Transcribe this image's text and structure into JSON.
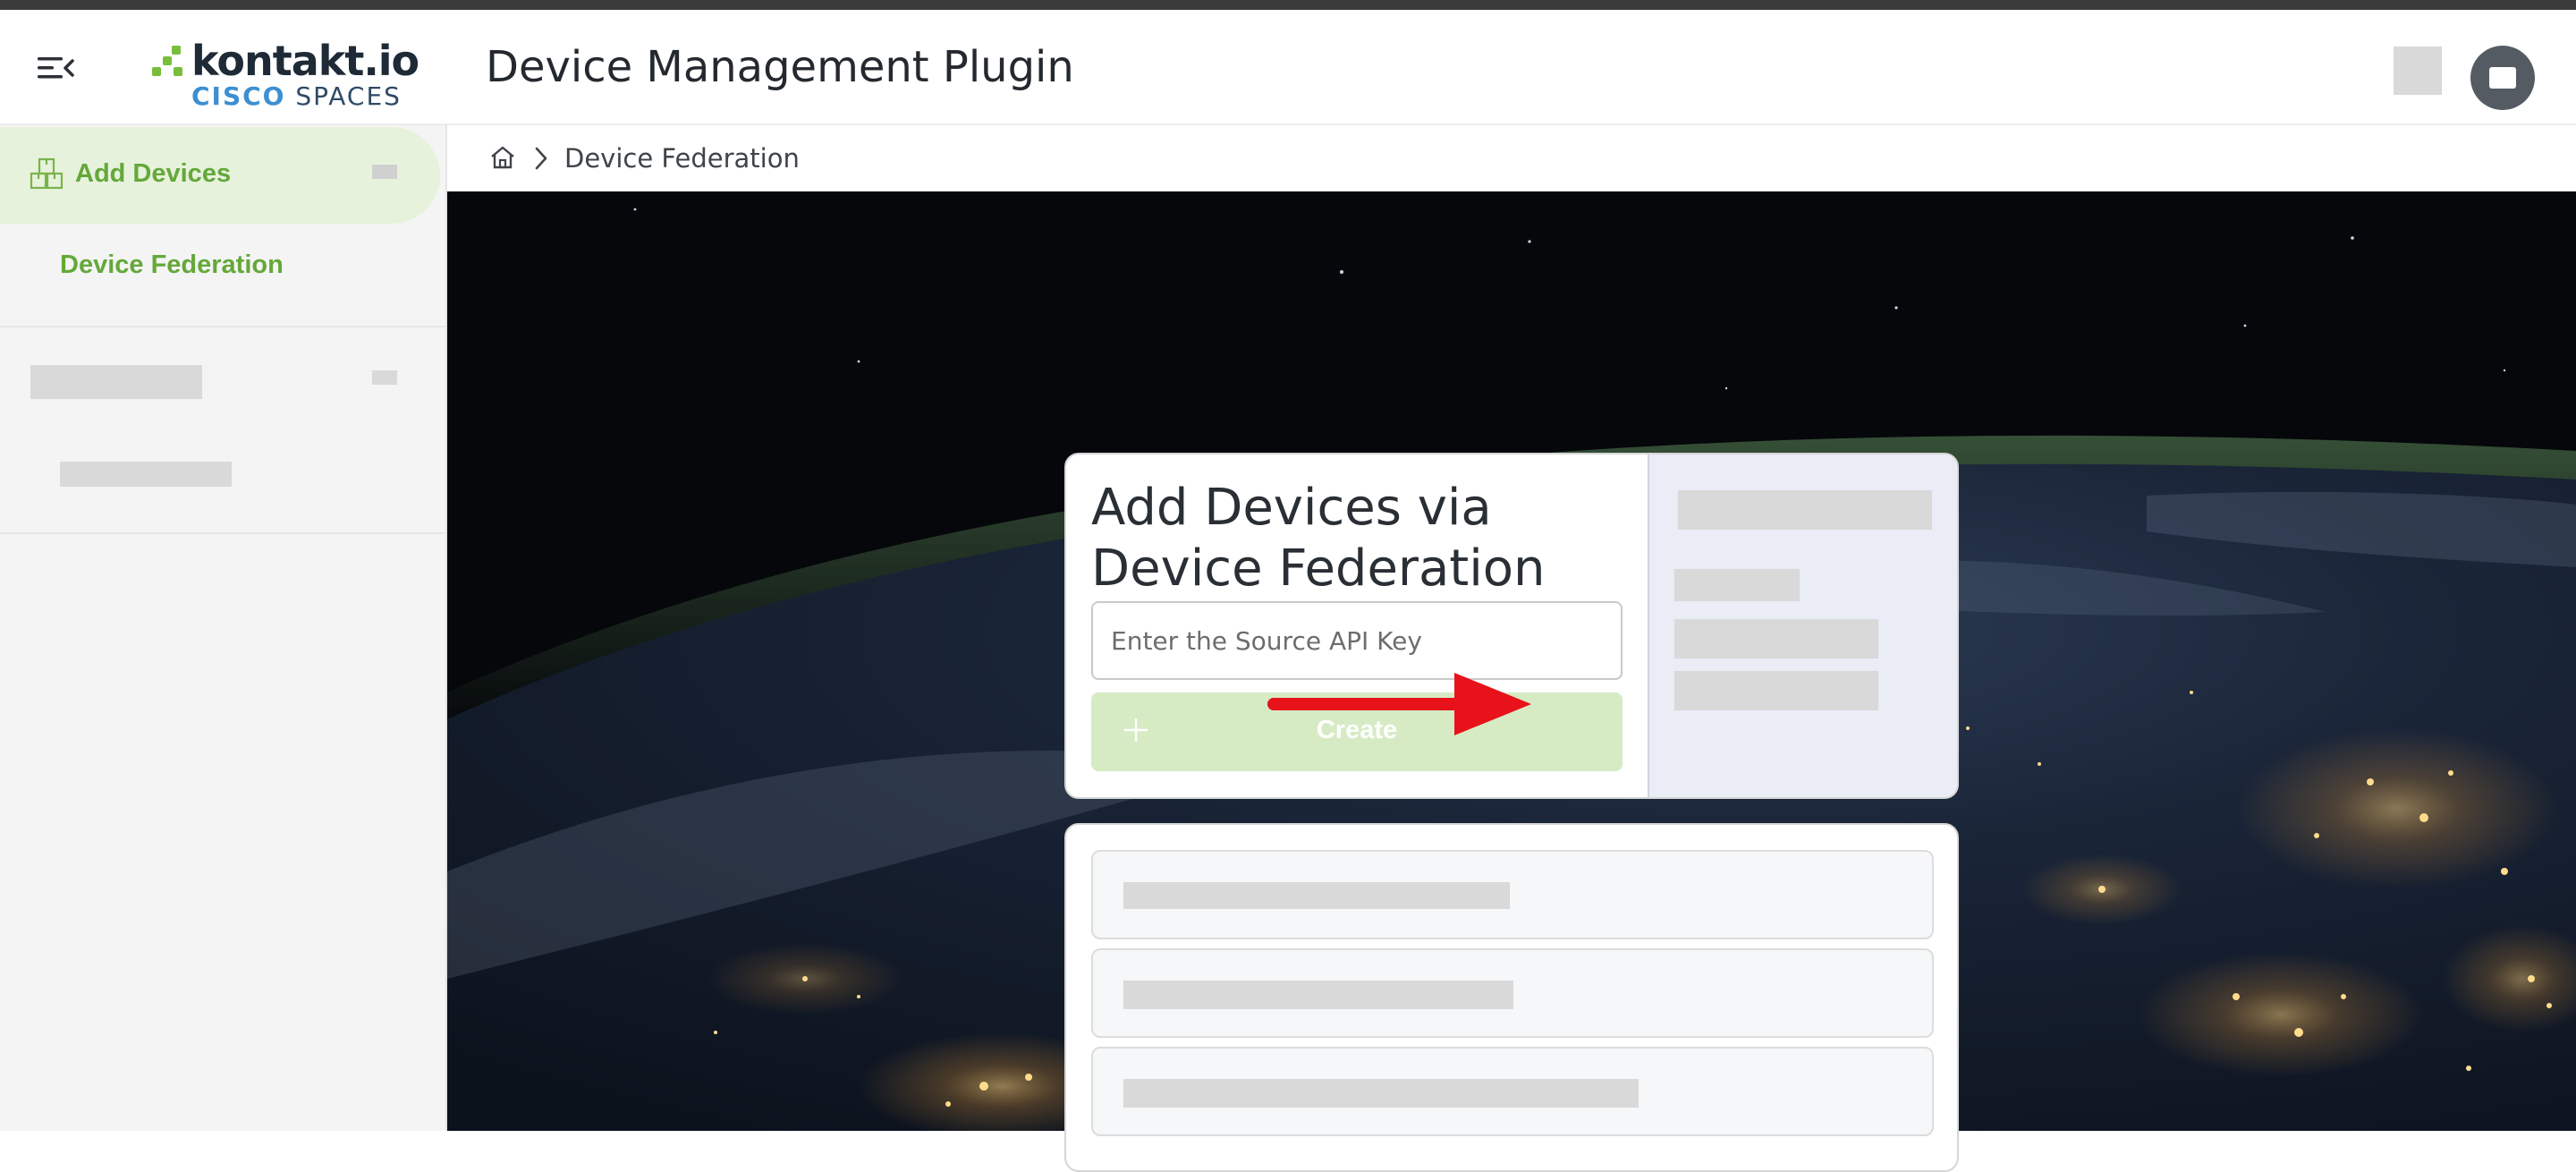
{
  "header": {
    "logo": {
      "word": "kontakt.io",
      "sub_brand": "CISCO",
      "sub_product": "SPACES"
    },
    "title": "Device Management Plugin"
  },
  "sidebar": {
    "parent": {
      "label": "Add Devices",
      "icon": "boxes-icon"
    },
    "child": {
      "label": "Device Federation"
    }
  },
  "breadcrumb": {
    "home_icon": "home-icon",
    "current": "Device Federation"
  },
  "federation_card": {
    "title": "Add Devices via Device Federation",
    "api_key_input": {
      "value": "",
      "placeholder": "Enter the Source API Key"
    },
    "create_button": {
      "label": "Create",
      "icon": "plus-icon"
    }
  },
  "colors": {
    "accent_green": "#64a83a",
    "active_nav_bg": "#e7f2dc",
    "create_button_bg": "#d6ebc4",
    "arrow_red": "#e8121a"
  }
}
